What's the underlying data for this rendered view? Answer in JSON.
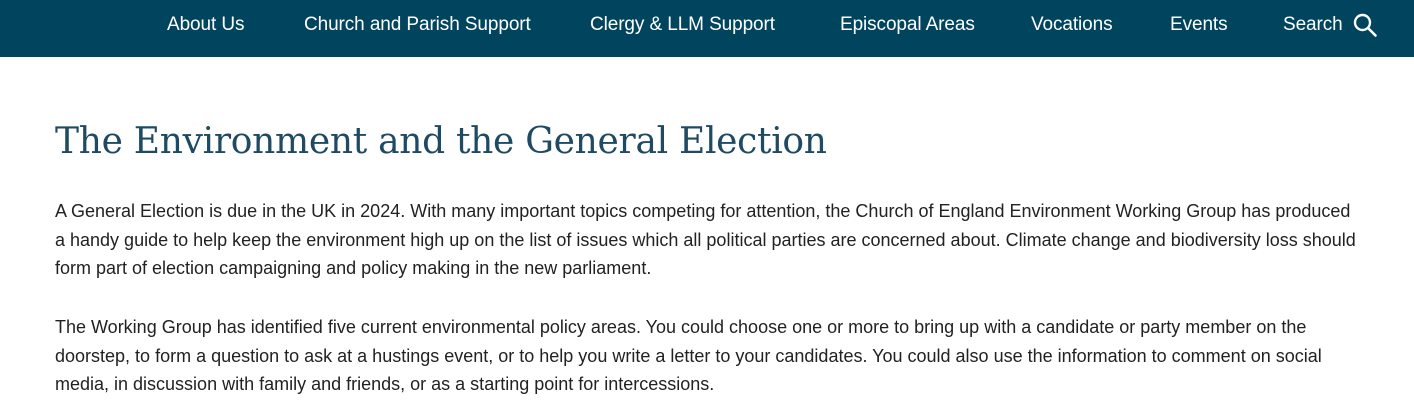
{
  "nav": {
    "items": [
      {
        "label": "About Us"
      },
      {
        "label": "Church and Parish Support"
      },
      {
        "label": "Clergy & LLM Support"
      },
      {
        "label": "Episcopal Areas"
      },
      {
        "label": "Vocations"
      },
      {
        "label": "Events"
      }
    ],
    "search_label": "Search",
    "search_icon": "search-icon",
    "background_color": "#00445e"
  },
  "main": {
    "title": "The Environment and the General Election",
    "title_color": "#1f4a63",
    "paragraphs": [
      "A General Election is due in the UK in 2024. With many important topics competing for attention, the Church of England Environment Working Group has produced a handy guide to help keep the environment high up on the list of issues which all political parties are concerned about. Climate change and biodiversity loss should form part of election campaigning and policy making in the new parliament.",
      "The Working Group has identified five current environmental policy areas. You could choose one or more to bring up with a candidate or party member on the doorstep, to form a question to ask at a hustings event, or to help you write a letter to your candidates. You could also use the information to comment on social media, in discussion with family and friends, or as a starting point for intercessions."
    ]
  }
}
